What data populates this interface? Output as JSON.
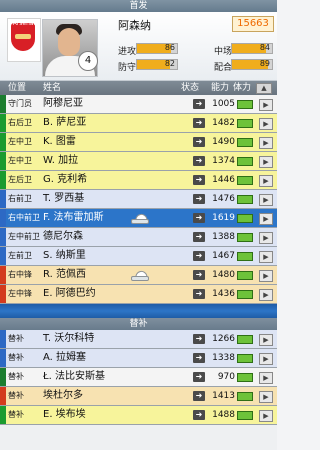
{
  "title_bar": {
    "label": "首发"
  },
  "player_card": {
    "club_name": "Arsenal",
    "player_name": "阿森纳",
    "shirt_number": "4",
    "rating": "15663",
    "stats": [
      {
        "label": "进攻",
        "value": "86",
        "fill": 0.86
      },
      {
        "label": "防守",
        "value": "82",
        "fill": 0.82
      },
      {
        "label": "中场",
        "value": "84",
        "fill": 0.84
      },
      {
        "label": "配合",
        "value": "89",
        "fill": 0.89
      }
    ]
  },
  "table_header": {
    "position": "位置",
    "name": "姓名",
    "status": "状态",
    "ability": "能力",
    "energy": "体力",
    "sort_icon": "up-arrow-icon"
  },
  "lineup": [
    {
      "position": "守门员",
      "name": "阿穆尼亚",
      "rating": "1005",
      "strip_color": "#1b7d2f",
      "bg": "#f4f4f4"
    },
    {
      "position": "右后卫",
      "name": "B. 萨尼亚",
      "rating": "1482",
      "strip_color": "#1b9b2f",
      "bg": "#f7f49b"
    },
    {
      "position": "左中卫",
      "name": "K. 图雷",
      "rating": "1490",
      "strip_color": "#1b9b2f",
      "bg": "#f7f49b"
    },
    {
      "position": "左中卫",
      "name": "W. 加拉",
      "rating": "1374",
      "strip_color": "#1b9b2f",
      "bg": "#f7f49b"
    },
    {
      "position": "左后卫",
      "name": "G. 克利希",
      "rating": "1446",
      "strip_color": "#1b9b2f",
      "bg": "#f7f49b"
    },
    {
      "position": "右前卫",
      "name": "T. 罗西基",
      "rating": "1476",
      "strip_color": "#2d69c4",
      "bg": "#dde4f4"
    },
    {
      "position": "右中前卫",
      "name": "F. 法布雷加斯",
      "rating": "1619",
      "strip_color": "#2d69c4",
      "bg": "#2c75c9",
      "selected": true,
      "status_icon": "boot-icon"
    },
    {
      "position": "左中前卫",
      "name": "德尼尔森",
      "rating": "1388",
      "strip_color": "#2d69c4",
      "bg": "#dde4f4"
    },
    {
      "position": "左前卫",
      "name": "S. 纳斯里",
      "rating": "1467",
      "strip_color": "#2d69c4",
      "bg": "#dde4f4"
    },
    {
      "position": "右中锋",
      "name": "R. 范佩西",
      "rating": "1480",
      "strip_color": "#d33b1e",
      "bg": "#f7e2b1",
      "status_icon": "boot-icon"
    },
    {
      "position": "左中锋",
      "name": "E. 阿德巴约",
      "rating": "1436",
      "strip_color": "#d33b1e",
      "bg": "#f7e2b1"
    }
  ],
  "bench_title": "替补",
  "bench": [
    {
      "position": "替补",
      "name": "T. 沃尔科特",
      "rating": "1266",
      "strip_color": "#2d69c4",
      "bg": "#dde4f4"
    },
    {
      "position": "替补",
      "name": "A. 拉姆塞",
      "rating": "1338",
      "strip_color": "#2d69c4",
      "bg": "#dde4f4"
    },
    {
      "position": "替补",
      "name": "Ł. 法比安斯基",
      "rating": "970",
      "strip_color": "#1b7d2f",
      "bg": "#f4f4f4"
    },
    {
      "position": "替补",
      "name": "埃杜尔多",
      "rating": "1413",
      "strip_color": "#d33b1e",
      "bg": "#f7e2b1"
    },
    {
      "position": "替补",
      "name": "E. 埃布埃",
      "rating": "1488",
      "strip_color": "#1b9b2f",
      "bg": "#f7f49b"
    }
  ]
}
